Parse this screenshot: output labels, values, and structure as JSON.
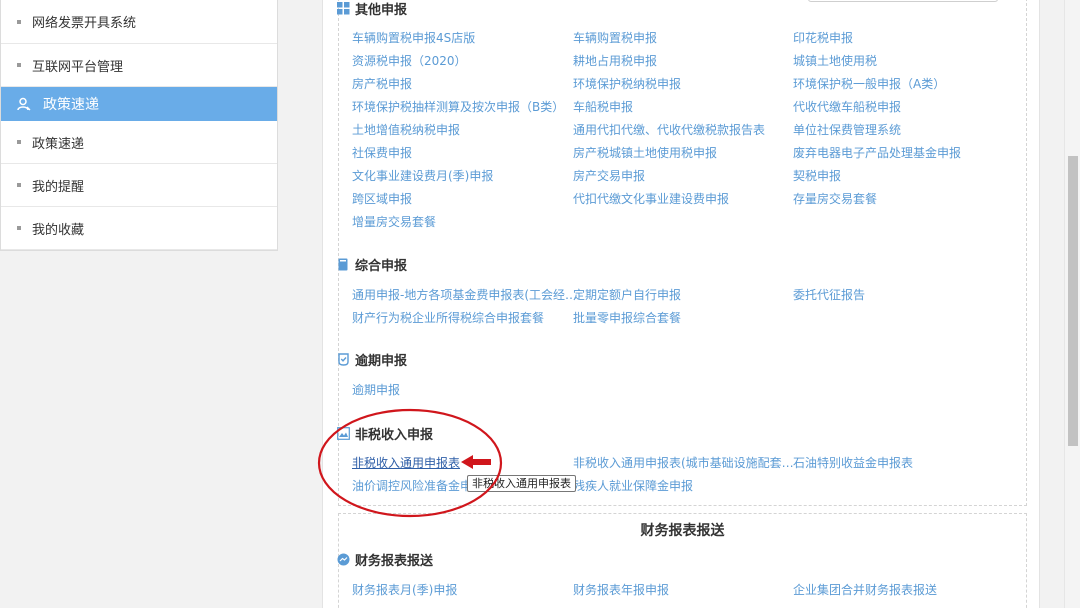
{
  "sidebar": {
    "items": [
      {
        "label": "网络发票开具系统"
      },
      {
        "label": "互联网平台管理"
      },
      {
        "label": "政策速递"
      },
      {
        "label": "政策速递"
      },
      {
        "label": "我的提醒"
      },
      {
        "label": "我的收藏"
      }
    ],
    "active_index": 2
  },
  "other_declare": {
    "title": "其他申报",
    "links": [
      "车辆购置税申报4S店版",
      "车辆购置税申报",
      "印花税申报",
      "资源税申报（2020）",
      "耕地占用税申报",
      "城镇土地使用税",
      "房产税申报",
      "环境保护税纳税申报",
      "环境保护税一般申报（A类）",
      "环境保护税抽样测算及按次申报（B类）",
      "车船税申报",
      "代收代缴车船税申报",
      "土地增值税纳税申报",
      "通用代扣代缴、代收代缴税款报告表",
      "单位社保费管理系统",
      "社保费申报",
      "房产税城镇土地使用税申报",
      "废弃电器电子产品处理基金申报",
      "文化事业建设费月(季)申报",
      "房产交易申报",
      "契税申报",
      "跨区域申报",
      "代扣代缴文化事业建设费申报",
      "存量房交易套餐",
      "增量房交易套餐"
    ]
  },
  "comprehensive_declare": {
    "title": "综合申报",
    "links": [
      "通用申报-地方各项基金费申报表(工会经…",
      "定期定额户自行申报",
      "委托代征报告",
      "财产行为税企业所得税综合申报套餐",
      "批量零申报综合套餐"
    ]
  },
  "overdue_declare": {
    "title": "逾期申报",
    "links": [
      "逾期申报"
    ]
  },
  "nontax_declare": {
    "title": "非税收入申报",
    "links": [
      "非税收入通用申报表",
      "非税收入通用申报表(城市基础设施配套…",
      "石油特别收益金申报表",
      "油价调控风险准备金申",
      "残疾人就业保障金申报"
    ],
    "tooltip": "非税收入通用申报表"
  },
  "financial_report": {
    "box_title": "财务报表报送",
    "title": "财务报表报送",
    "links": [
      "财务报表月(季)申报",
      "财务报表年报申报",
      "企业集团合并财务报表报送"
    ]
  },
  "colors": {
    "link": "#5b9bd5",
    "link_active": "#2f5fa8",
    "sidebar_active": "#69ace8",
    "annotation": "#d0161c"
  },
  "icons": {
    "sidebar_active": "user-icon",
    "other_declare": "grid-icon",
    "comprehensive_declare": "book-icon",
    "overdue_declare": "clock-icon",
    "nontax_declare": "image-icon",
    "financial_report": "chart-icon"
  }
}
